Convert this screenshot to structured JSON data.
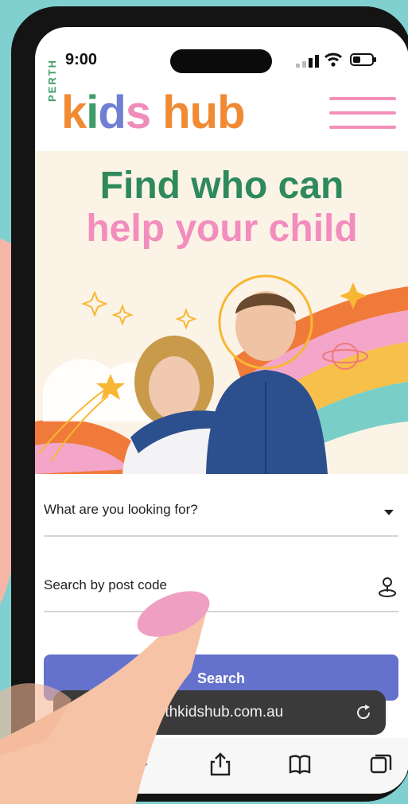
{
  "status_bar": {
    "time": "9:00"
  },
  "header": {
    "logo_small": "PERTH",
    "logo_letters": [
      {
        "ch": "k",
        "color": "#f08a33"
      },
      {
        "ch": "i",
        "color": "#3f9d69"
      },
      {
        "ch": "d",
        "color": "#6f7fd3"
      },
      {
        "ch": "s",
        "color": "#ef8cbb"
      },
      {
        "ch": " ",
        "color": "#ffffff"
      },
      {
        "ch": "h",
        "color": "#f08a33"
      },
      {
        "ch": "u",
        "color": "#f08a33"
      },
      {
        "ch": "b",
        "color": "#f08a33"
      }
    ]
  },
  "hero": {
    "title_line1": "Find who can",
    "title_line2": "help your child"
  },
  "form": {
    "service_select_label": "What are you looking for?",
    "postcode_label": "Search by post code",
    "search_label": "Search"
  },
  "browser": {
    "url": "rthkidshub.com.au"
  },
  "colors": {
    "brand_green": "#2f8a5b",
    "brand_pink": "#f28dbd",
    "brand_orange": "#f08a33",
    "button_blue": "#6472cd"
  }
}
